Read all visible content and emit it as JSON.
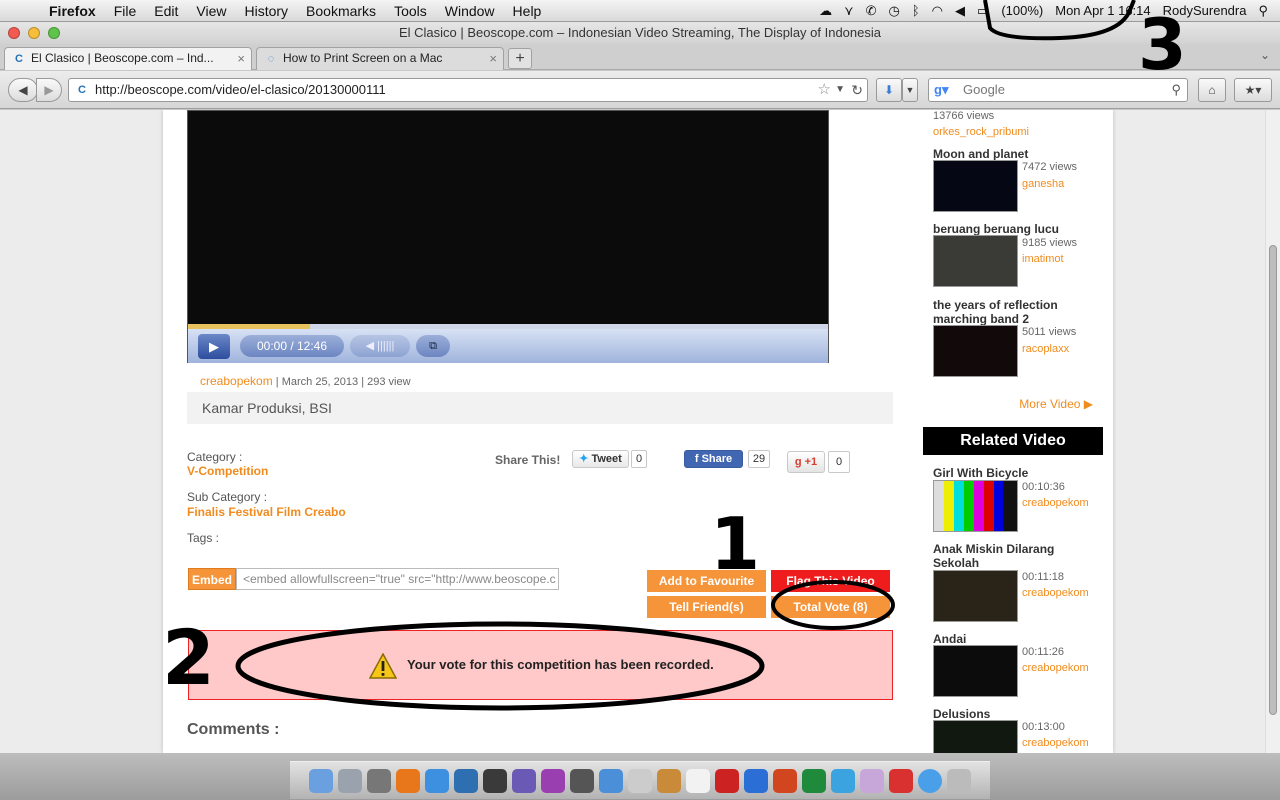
{
  "menubar": {
    "app": "Firefox",
    "items": [
      "File",
      "Edit",
      "View",
      "History",
      "Bookmarks",
      "Tools",
      "Window",
      "Help"
    ],
    "battery": "(100%)",
    "clock": "Mon Apr 1  16:14",
    "user": "RodySurendra"
  },
  "window": {
    "title": "El Clasico | Beoscope.com – Indonesian Video Streaming, The Display of Indonesia"
  },
  "tabs": [
    {
      "label": "El Clasico | Beoscope.com – Ind...",
      "favicon": "C"
    },
    {
      "label": "How to Print Screen on a Mac",
      "favicon": "◌"
    }
  ],
  "navbar": {
    "url": "http://beoscope.com/video/el-clasico/20130000111",
    "search_placeholder": "Google"
  },
  "video": {
    "time": "00:00 / 12:46",
    "buffered": 0.19
  },
  "meta": {
    "uploader": "creabopekom",
    "date": "March 25, 2013",
    "views": "293 view",
    "studio": "Kamar Produksi, BSI"
  },
  "details": {
    "category_label": "Category :",
    "category": "V-Competition",
    "subcategory_label": "Sub Category :",
    "subcategory": "Finalis Festival Film Creabo",
    "tags_label": "Tags :"
  },
  "share": {
    "label": "Share This!",
    "tweet": "Tweet",
    "tweet_count": "0",
    "fb": "Share",
    "fb_count": "29",
    "gplus": "+1",
    "gplus_count": "0"
  },
  "embed": {
    "label": "Embed",
    "code": "<embed allowfullscreen=\"true\" src=\"http://www.beoscope.c"
  },
  "actions": {
    "favourite": "Add to Favourite",
    "flag": "Flag This Video",
    "tell": "Tell Friend(s)",
    "vote": "Total Vote (8)"
  },
  "alert": {
    "message": "Your vote for this competition has been recorded."
  },
  "comments": {
    "heading": "Comments :"
  },
  "sidebar": {
    "top_views": "13766 views",
    "top_user": "orkes_rock_pribumi",
    "videos": [
      {
        "title": "Moon and planet",
        "info": "7472 views",
        "user": "ganesha"
      },
      {
        "title": "beruang beruang lucu",
        "info": "9185 views",
        "user": "imatimot"
      },
      {
        "title": "the years of reflection marching band 2",
        "info": "5011 views",
        "user": "racoplaxx"
      }
    ],
    "more": "More Video ▶",
    "related_heading": "Related Video",
    "related": [
      {
        "title": "Girl With Bicycle",
        "info": "00:10:36",
        "user": "creabopekom"
      },
      {
        "title": "Anak Miskin Dilarang Sekolah",
        "info": "00:11:18",
        "user": "creabopekom"
      },
      {
        "title": "Andai",
        "info": "00:11:26",
        "user": "creabopekom"
      },
      {
        "title": "Delusions",
        "info": "00:13:00",
        "user": "creabopekom"
      }
    ]
  },
  "annotations": {
    "one": "1",
    "two": "2",
    "three": "3"
  },
  "colors": {
    "accent_orange": "#f6943a",
    "flag_red": "#ee1c1c",
    "alert_bg": "#ffc9c9"
  }
}
